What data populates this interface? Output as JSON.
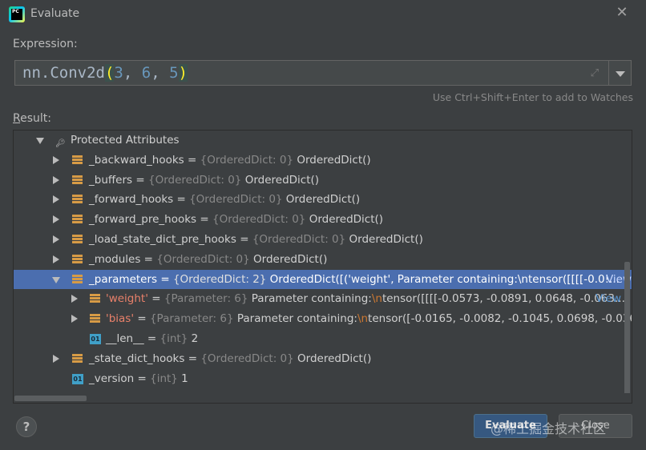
{
  "window": {
    "title": "Evaluate",
    "app_icon_text": "PC",
    "close_glyph": "✕"
  },
  "expression": {
    "label": "Expression:",
    "fn": "nn.Conv2d",
    "open_paren": "(",
    "arg1": "3",
    "sep1": ", ",
    "arg2": "6",
    "sep2": ", ",
    "arg3": "5",
    "close_paren": ")",
    "hint": "Use Ctrl+Shift+Enter to add to Watches"
  },
  "result": {
    "label_prefix": "R",
    "label_rest": "esult:",
    "rows": [
      {
        "name": "Protected Attributes"
      },
      {
        "name": "_backward_hooks",
        "eq": " = ",
        "type": "{OrderedDict: 0}",
        "value": " OrderedDict()"
      },
      {
        "name": "_buffers",
        "eq": " = ",
        "type": "{OrderedDict: 0}",
        "value": " OrderedDict()"
      },
      {
        "name": "_forward_hooks",
        "eq": " = ",
        "type": "{OrderedDict: 0}",
        "value": " OrderedDict()"
      },
      {
        "name": "_forward_pre_hooks",
        "eq": " = ",
        "type": "{OrderedDict: 0}",
        "value": " OrderedDict()"
      },
      {
        "name": "_load_state_dict_pre_hooks",
        "eq": " = ",
        "type": "{OrderedDict: 0}",
        "value": " OrderedDict()"
      },
      {
        "name": "_modules",
        "eq": " = ",
        "type": "{OrderedDict: 0}",
        "value": " OrderedDict()"
      },
      {
        "name": "_parameters",
        "eq": " = ",
        "type": "{OrderedDict: 2}",
        "value": " OrderedDict([('weight', Parameter containing:\\ntensor([[[[-0.0!...",
        "view": "View"
      },
      {
        "name": "'weight'",
        "eq": " = ",
        "type": "{Parameter: 6}",
        "value_a": " Parameter containing:",
        "esc": "\\n",
        "value_b": "tensor([[[[-0.0573, -0.0891,  0.0648, -0.063...",
        "view": "View"
      },
      {
        "name": "'bias'",
        "eq": " = ",
        "type": "{Parameter: 6}",
        "value_a": " Parameter containing:",
        "esc": "\\n",
        "value_b": "tensor([-0.0165, -0.0082, -0.1045,  0.0698, -0.0367, ("
      },
      {
        "name": "__len__",
        "eq": " = ",
        "type": "{int}",
        "value": " 2",
        "icon_text": "01"
      },
      {
        "name": "_state_dict_hooks",
        "eq": " = ",
        "type": "{OrderedDict: 0}",
        "value": " OrderedDict()"
      },
      {
        "name": "_version",
        "eq": " = ",
        "type": "{int}",
        "value": " 1",
        "icon_text": "01"
      }
    ]
  },
  "buttons": {
    "help": "?",
    "evaluate": "Evaluate",
    "close": "Close"
  },
  "watermark": "@稀土掘金技术社区",
  "colors": {
    "selection": "#4b6eaf",
    "field_icon": "#d79b46",
    "int_icon": "#40a0c8",
    "view_link": "#5894d0"
  }
}
